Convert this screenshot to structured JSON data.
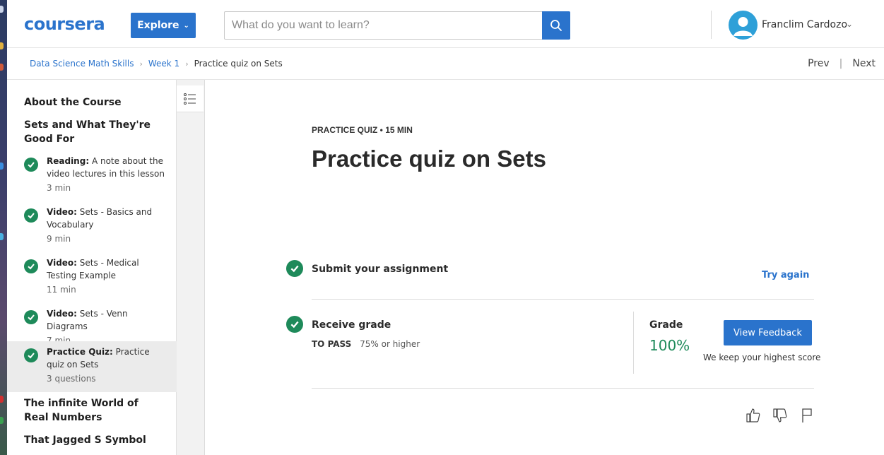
{
  "header": {
    "logo": "coursera",
    "explore_label": "Explore",
    "search_placeholder": "What do you want to learn?",
    "user_name": "Franclim Cardozo"
  },
  "breadcrumb": {
    "items": [
      "Data Science Math Skills",
      "Week 1",
      "Practice quiz on Sets"
    ],
    "prev": "Prev",
    "next": "Next"
  },
  "sidebar": {
    "sections": [
      "About the Course",
      "Sets and What They're Good For",
      "The infinite World of Real Numbers",
      "That Jagged S Symbol"
    ],
    "items": [
      {
        "kind": "Reading:",
        "title": "A note about the video lectures in this lesson",
        "meta": "3 min"
      },
      {
        "kind": "Video:",
        "title": "Sets - Basics and Vocabulary",
        "meta": "9 min"
      },
      {
        "kind": "Video:",
        "title": "Sets - Medical Testing Example",
        "meta": "11 min"
      },
      {
        "kind": "Video:",
        "title": "Sets - Venn Diagrams",
        "meta": "7 min"
      },
      {
        "kind": "Practice Quiz:",
        "title": "Practice quiz on Sets",
        "meta": "3 questions"
      }
    ]
  },
  "main": {
    "kicker": "PRACTICE QUIZ • 15 MIN",
    "title": "Practice quiz on Sets",
    "submit_title": "Submit your assignment",
    "try_again": "Try again",
    "receive_title": "Receive grade",
    "to_pass_label": "TO PASS",
    "to_pass_value": "75% or higher",
    "grade_label": "Grade",
    "grade_value": "100%",
    "view_feedback": "View Feedback",
    "highest_note": "We keep your highest score"
  },
  "colors": {
    "brand_blue": "#2a73cc",
    "success_green": "#1e8a5a"
  }
}
